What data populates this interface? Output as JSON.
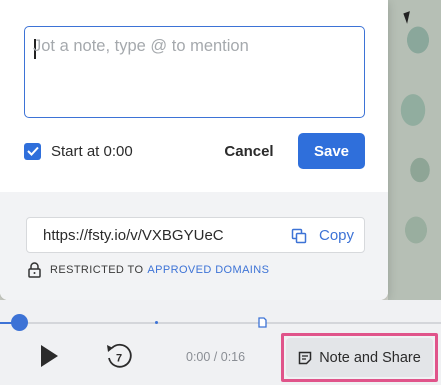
{
  "note": {
    "placeholder": "Jot a note, type @ to mention",
    "start_at_label": "Start at 0:00",
    "start_at_checked": true,
    "cancel_label": "Cancel",
    "save_label": "Save"
  },
  "share": {
    "url": "https://fsty.io/v/VXBGYUeC",
    "copy_label": "Copy",
    "restricted_prefix": "RESTRICTED TO",
    "restricted_link": "APPROVED DOMAINS"
  },
  "player": {
    "time": "0:00 / 0:16",
    "rewind_seconds": "7",
    "note_share_label": "Note and Share",
    "progress": 0
  },
  "colors": {
    "accent": "#2f6fdb",
    "highlight": "#e0548a"
  },
  "icons": [
    "checkbox-check-icon",
    "copy-icon",
    "lock-icon",
    "play-icon",
    "rewind-icon",
    "note-icon",
    "note-marker-icon"
  ]
}
